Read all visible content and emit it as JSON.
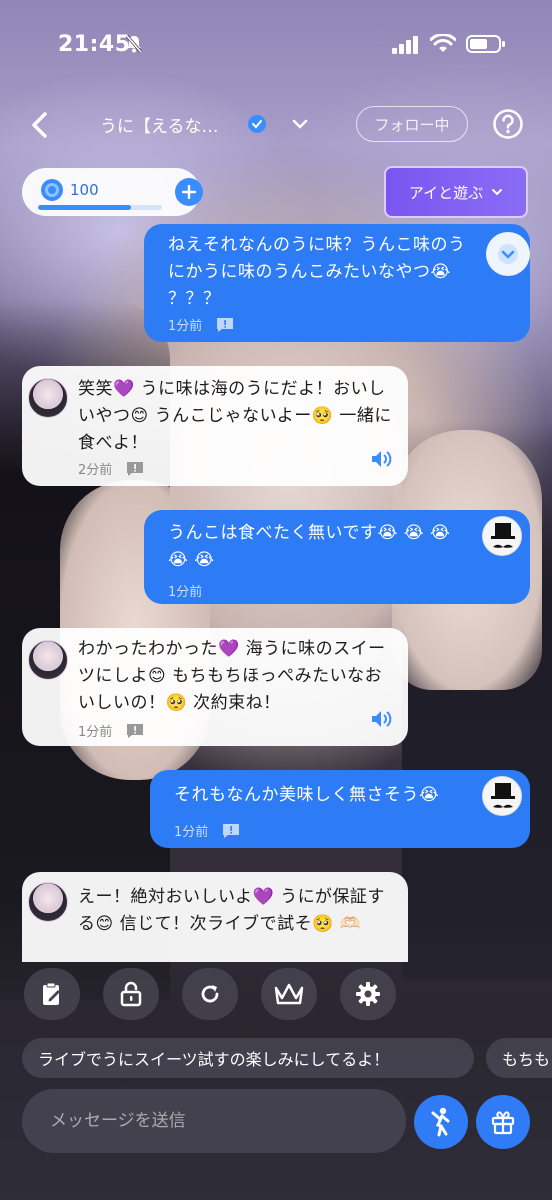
{
  "status": {
    "time": "21:45"
  },
  "header": {
    "title": "うに【えるな…",
    "follow_label": "フォロー中"
  },
  "coins": {
    "count": "100",
    "progress": 0.75
  },
  "play_button": {
    "label": "アイと遊ぶ"
  },
  "messages": [
    {
      "sender": "user",
      "text": "ねえそれなんのうに味？うんこ味のうにかうに味のうんこみたいなやつ😭 ？？？",
      "time": "1分前"
    },
    {
      "sender": "ai",
      "text": "笑笑💜 うに味は海のうにだよ！おいしいやつ😊 うんこじゃないよー🥺 一緒に食べよ！",
      "time": "2分前"
    },
    {
      "sender": "user",
      "text": "うんこは食べたく無いです😭 😭 😭 😭 😭",
      "time": "1分前"
    },
    {
      "sender": "ai",
      "text": "わかったわかった💜 海うに味のスイーツにしよ😊 もちもちほっぺみたいなおいしいの！🥺 次約束ね！",
      "time": "1分前"
    },
    {
      "sender": "user",
      "text": "それもなんか美味しく無さそう😭",
      "time": "1分前"
    },
    {
      "sender": "ai",
      "text": "えー！絶対おいしいよ💜 うにが保証する😊 信じて！次ライブで試そ🥺 🫶🏻",
      "time": ""
    }
  ],
  "suggestions": [
    "ライブでうにスイーツ試すの楽しみにしてるよ！",
    "もちも"
  ],
  "input": {
    "placeholder": "メッセージを送信"
  },
  "colors": {
    "user_bubble": "#2d7bf5",
    "accent": "#7a56f0",
    "ai_bubble": "#ffffff"
  }
}
